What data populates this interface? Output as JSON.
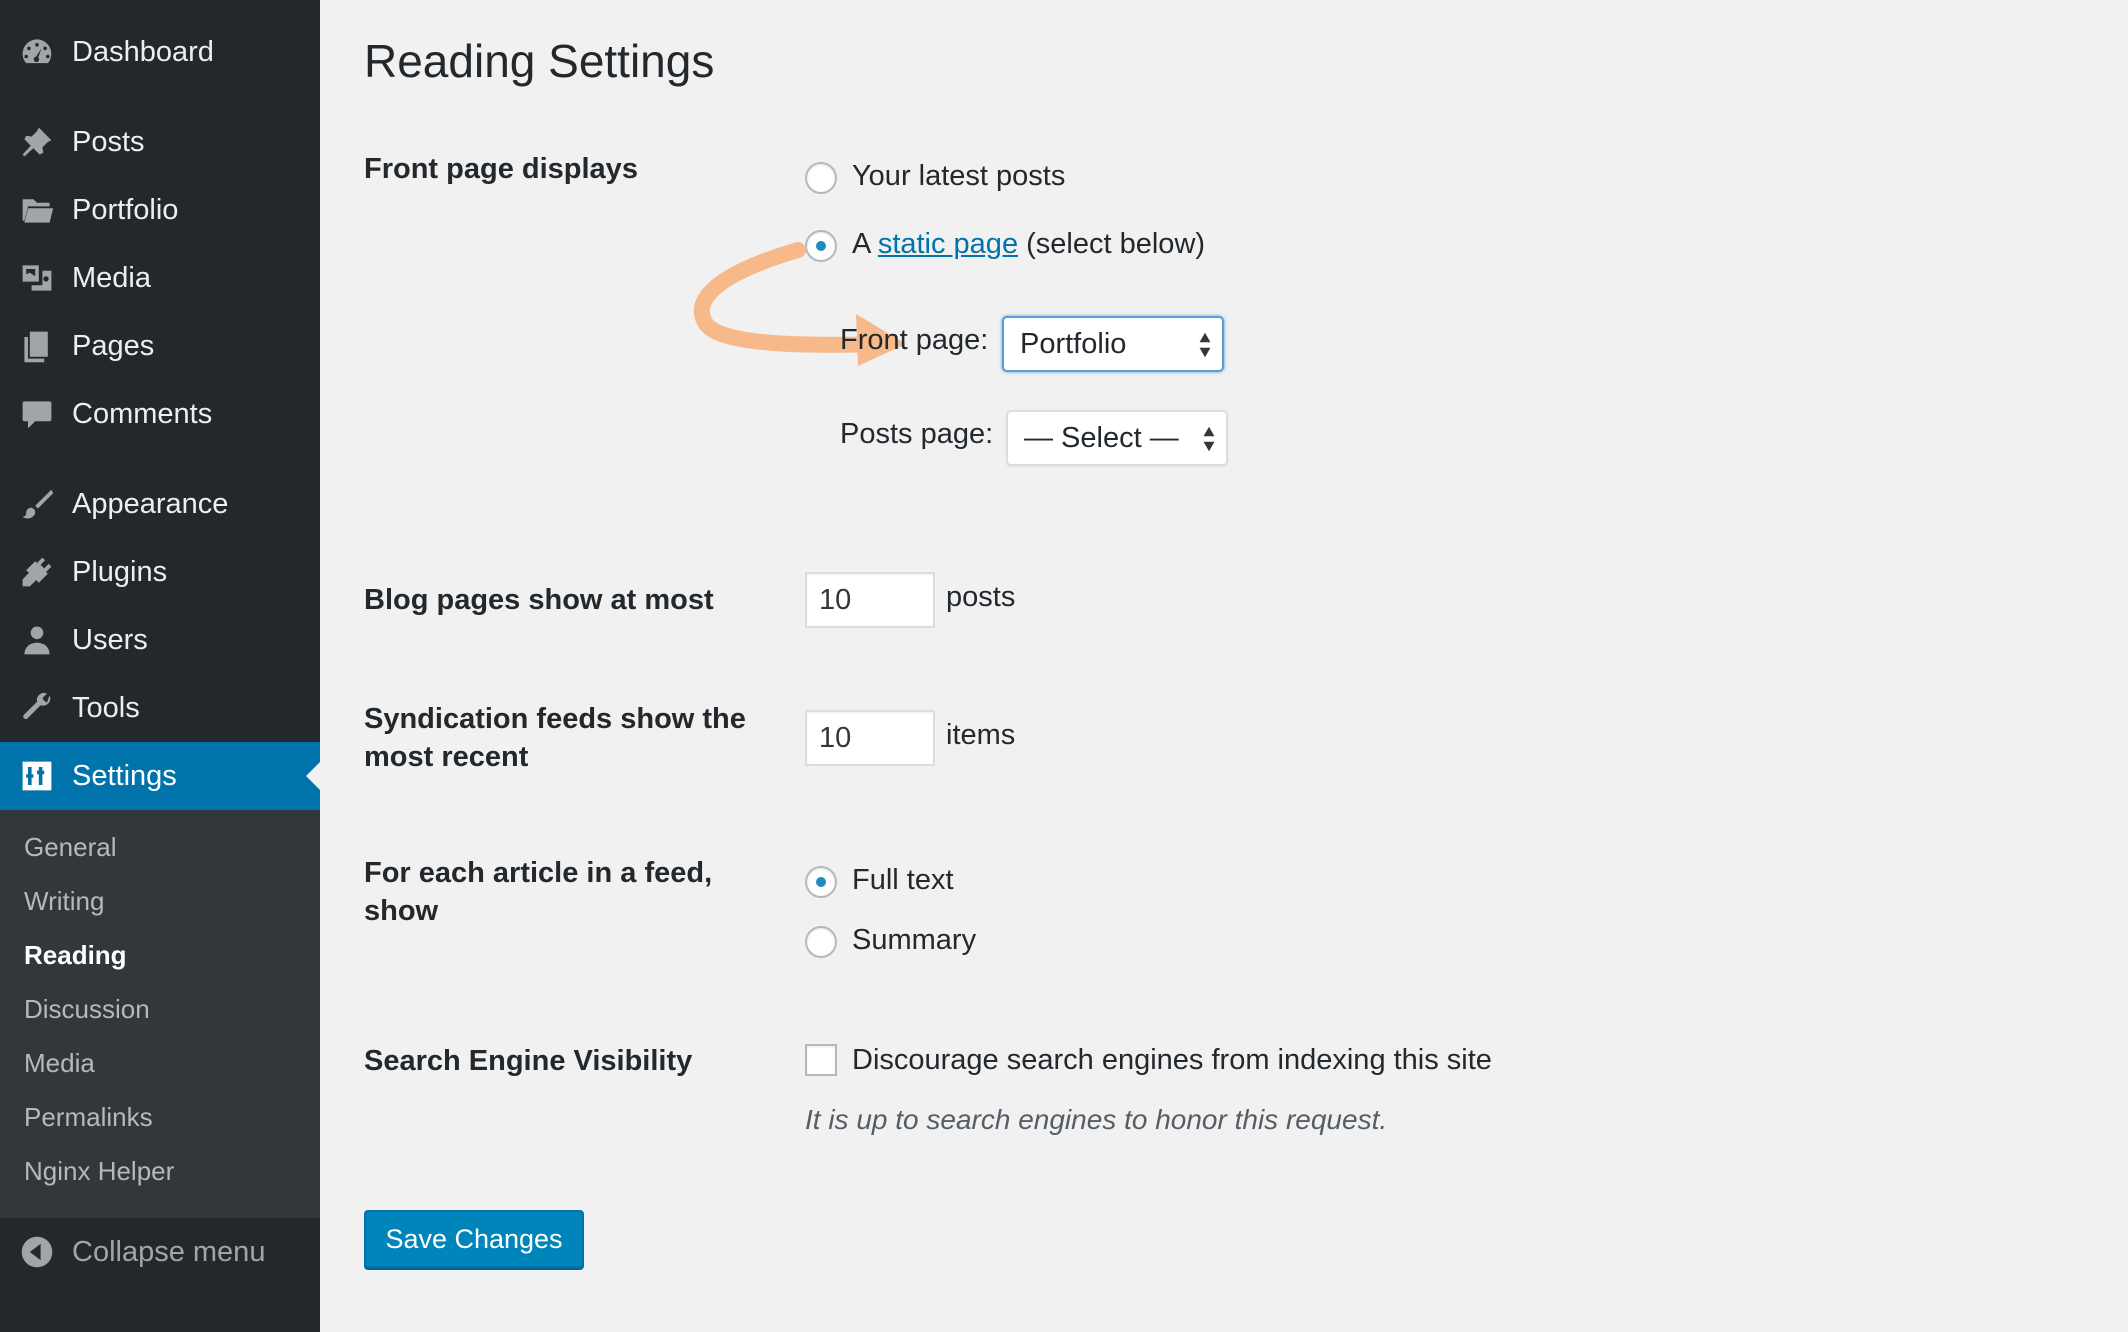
{
  "sidebar": {
    "items": [
      {
        "label": "Dashboard",
        "icon": "dashboard-icon"
      },
      {
        "label": "Posts",
        "icon": "pushpin-icon"
      },
      {
        "label": "Portfolio",
        "icon": "folder-icon"
      },
      {
        "label": "Media",
        "icon": "media-icon"
      },
      {
        "label": "Pages",
        "icon": "pages-icon"
      },
      {
        "label": "Comments",
        "icon": "comment-bubble-icon"
      },
      {
        "label": "Appearance",
        "icon": "paintbrush-icon"
      },
      {
        "label": "Plugins",
        "icon": "plug-icon"
      },
      {
        "label": "Users",
        "icon": "user-icon"
      },
      {
        "label": "Tools",
        "icon": "wrench-icon"
      },
      {
        "label": "Settings",
        "icon": "sliders-icon"
      }
    ],
    "submenu": [
      "General",
      "Writing",
      "Reading",
      "Discussion",
      "Media",
      "Permalinks",
      "Nginx Helper"
    ],
    "current_submenu": "Reading",
    "collapse_label": "Collapse menu",
    "colors": {
      "background": "#23282d",
      "submenu_background": "#32373c",
      "active": "#0073aa"
    }
  },
  "page": {
    "title": "Reading Settings",
    "front_page_displays": {
      "label": "Front page displays",
      "option_latest": "Your latest posts",
      "option_static_prefix": "A",
      "option_static_link": "static page",
      "option_static_suffix": "(select below)",
      "selected": "static page",
      "front_page_label": "Front page:",
      "front_page_value": "Portfolio",
      "posts_page_label": "Posts page:",
      "posts_page_value": "— Select —"
    },
    "blog_pages": {
      "label": "Blog pages show at most",
      "value": "10",
      "unit": "posts"
    },
    "syndication": {
      "label": "Syndication feeds show the most recent",
      "value": "10",
      "unit": "items"
    },
    "feed_article": {
      "label": "For each article in a feed, show",
      "option_full": "Full text",
      "option_summary": "Summary",
      "selected": "Full text"
    },
    "search_visibility": {
      "label": "Search Engine Visibility",
      "checkbox_label": "Discourage search engines from indexing this site",
      "checked": false,
      "description": "It is up to search engines to honor this request."
    },
    "save_button": "Save Changes",
    "annotation_color": "#f8b98a"
  }
}
